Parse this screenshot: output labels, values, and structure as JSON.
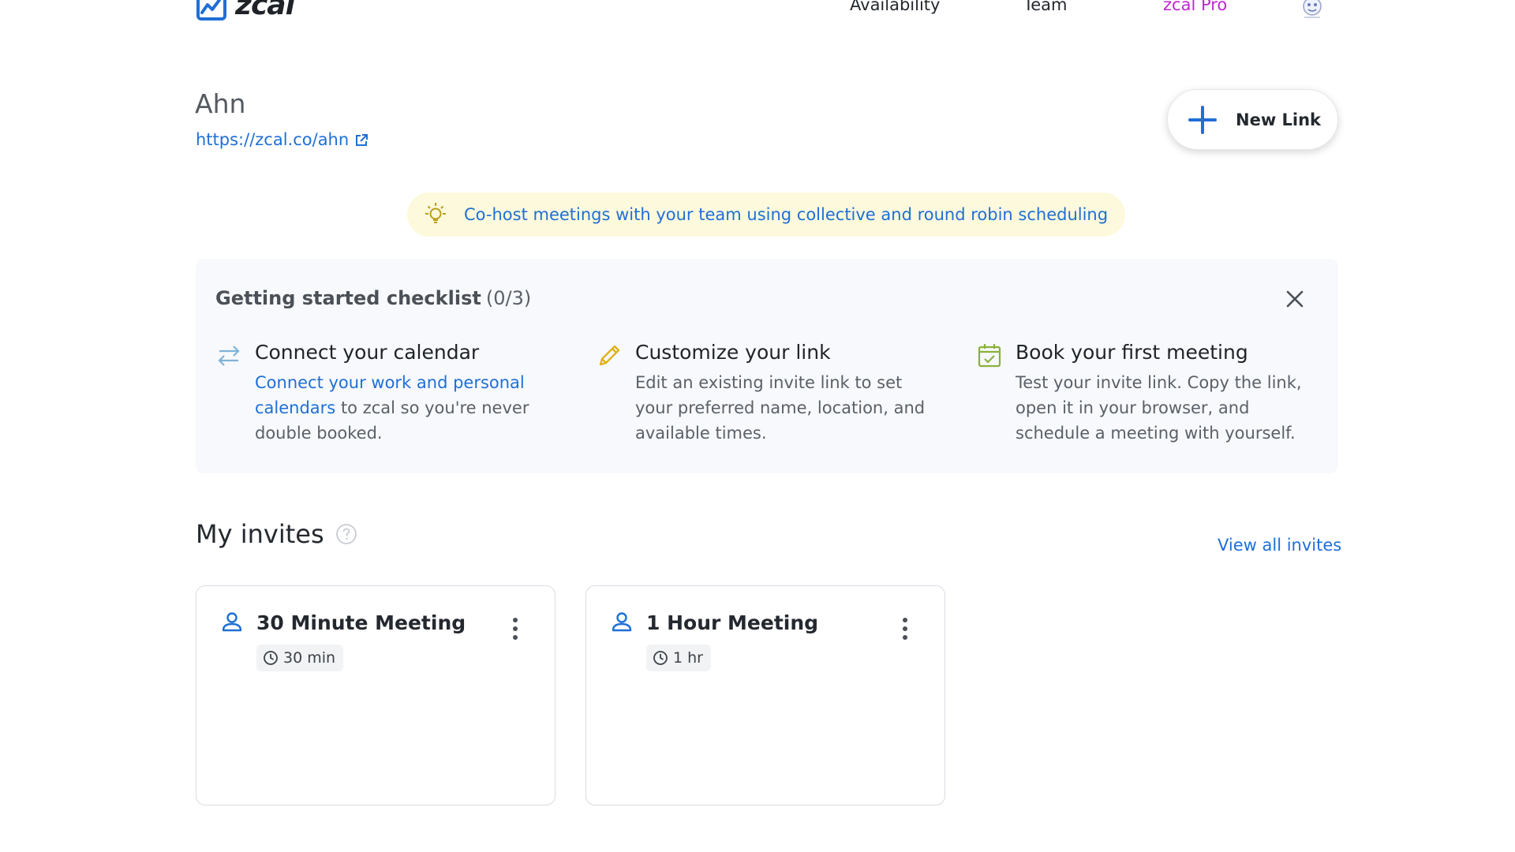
{
  "header": {
    "logo_text": "zcal",
    "nav": {
      "availability": "Availability",
      "team": "Team",
      "pro": "zcal Pro"
    }
  },
  "profile": {
    "name": "Ahn",
    "link": "https://zcal.co/ahn",
    "new_link_label": "New Link"
  },
  "banner": {
    "text": "Co-host meetings with your team using collective and round robin scheduling"
  },
  "checklist": {
    "title": "Getting started checklist",
    "count": "(0/3)",
    "steps": [
      {
        "title": "Connect your calendar",
        "desc_link": "Connect your work and personal calendars",
        "desc": " to zcal so you're never double booked."
      },
      {
        "title": "Customize your link",
        "desc": "Edit an existing invite link to set your preferred name, location, and available times."
      },
      {
        "title": "Book your first meeting",
        "desc": "Test your invite link. Copy the link, open it in your browser, and schedule a meeting with yourself."
      }
    ]
  },
  "invites": {
    "title": "My invites",
    "view_all": "View all invites",
    "cards": [
      {
        "title": "30 Minute Meeting",
        "duration": "30 min"
      },
      {
        "title": "1 Hour Meeting",
        "duration": "1 hr"
      }
    ]
  },
  "icons": {
    "logo": "calendar-logo-icon",
    "new_link": "plus-icon",
    "external": "external-link-icon",
    "banner": "lightbulb-icon",
    "close": "close-icon",
    "step1": "swap-arrows-icon",
    "step2": "pencil-icon",
    "step3": "calendar-check-icon",
    "help": "help-circle-icon",
    "person": "person-icon",
    "menu": "more-vertical-icon",
    "clock": "clock-icon"
  },
  "colors": {
    "accent_blue": "#1f6fd6",
    "pro_magenta": "#c026d3",
    "banner_bg": "#fdf9dc",
    "checklist_bg": "#f7f9fc"
  }
}
